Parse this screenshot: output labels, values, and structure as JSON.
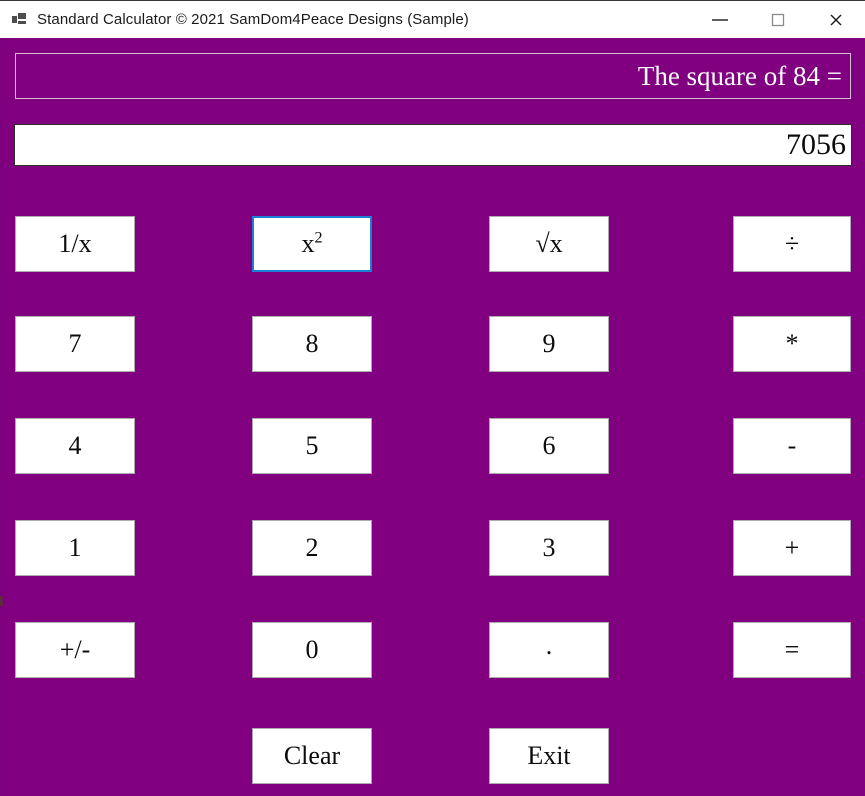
{
  "window": {
    "title": "Standard Calculator © 2021 SamDom4Peace Designs (Sample)",
    "icon": "app-window-icon",
    "controls": [
      {
        "name": "minimize",
        "glyph": "minimize-icon"
      },
      {
        "name": "maximize",
        "glyph": "maximize-icon"
      },
      {
        "name": "close",
        "glyph": "close-icon"
      }
    ]
  },
  "display": {
    "expression": "The square of 84 =",
    "result": "7056",
    "expression_placeholder": "",
    "result_placeholder": ""
  },
  "colors": {
    "background": "#800080",
    "button_face": "#ffffff",
    "button_border": "#acacac",
    "focus_ring": "#1b7fd4",
    "expression_text": "#ffffff",
    "result_text": "#0c0c0c",
    "titlebar": "#ffffff"
  },
  "keypad": {
    "buttons": [
      {
        "id": "reciprocal",
        "label": "1/x",
        "col": 1,
        "row": 1,
        "focused": false
      },
      {
        "id": "square",
        "label": "x²",
        "col": 2,
        "row": 1,
        "focused": true
      },
      {
        "id": "sqrt",
        "label": "√x",
        "col": 3,
        "row": 1,
        "focused": false
      },
      {
        "id": "divide",
        "label": "÷",
        "col": 4,
        "row": 1,
        "focused": false
      },
      {
        "id": "seven",
        "label": "7",
        "col": 1,
        "row": 2,
        "focused": false
      },
      {
        "id": "eight",
        "label": "8",
        "col": 2,
        "row": 2,
        "focused": false
      },
      {
        "id": "nine",
        "label": "9",
        "col": 3,
        "row": 2,
        "focused": false
      },
      {
        "id": "multiply",
        "label": "*",
        "col": 4,
        "row": 2,
        "focused": false
      },
      {
        "id": "four",
        "label": "4",
        "col": 1,
        "row": 3,
        "focused": false
      },
      {
        "id": "five",
        "label": "5",
        "col": 2,
        "row": 3,
        "focused": false
      },
      {
        "id": "six",
        "label": "6",
        "col": 3,
        "row": 3,
        "focused": false
      },
      {
        "id": "subtract",
        "label": "-",
        "col": 4,
        "row": 3,
        "focused": false
      },
      {
        "id": "one",
        "label": "1",
        "col": 1,
        "row": 4,
        "focused": false
      },
      {
        "id": "two",
        "label": "2",
        "col": 2,
        "row": 4,
        "focused": false
      },
      {
        "id": "three",
        "label": "3",
        "col": 3,
        "row": 4,
        "focused": false
      },
      {
        "id": "add",
        "label": "+",
        "col": 4,
        "row": 4,
        "focused": false
      },
      {
        "id": "sign",
        "label": "+/-",
        "col": 1,
        "row": 5,
        "focused": false
      },
      {
        "id": "zero",
        "label": "0",
        "col": 2,
        "row": 5,
        "focused": false
      },
      {
        "id": "decimal",
        "label": ".",
        "col": 3,
        "row": 5,
        "focused": false
      },
      {
        "id": "equals",
        "label": "=",
        "col": 4,
        "row": 5,
        "focused": false
      },
      {
        "id": "clear",
        "label": "Clear",
        "col": 2,
        "row": 6,
        "focused": false
      },
      {
        "id": "exit",
        "label": "Exit",
        "col": 3,
        "row": 6,
        "focused": false
      }
    ]
  }
}
